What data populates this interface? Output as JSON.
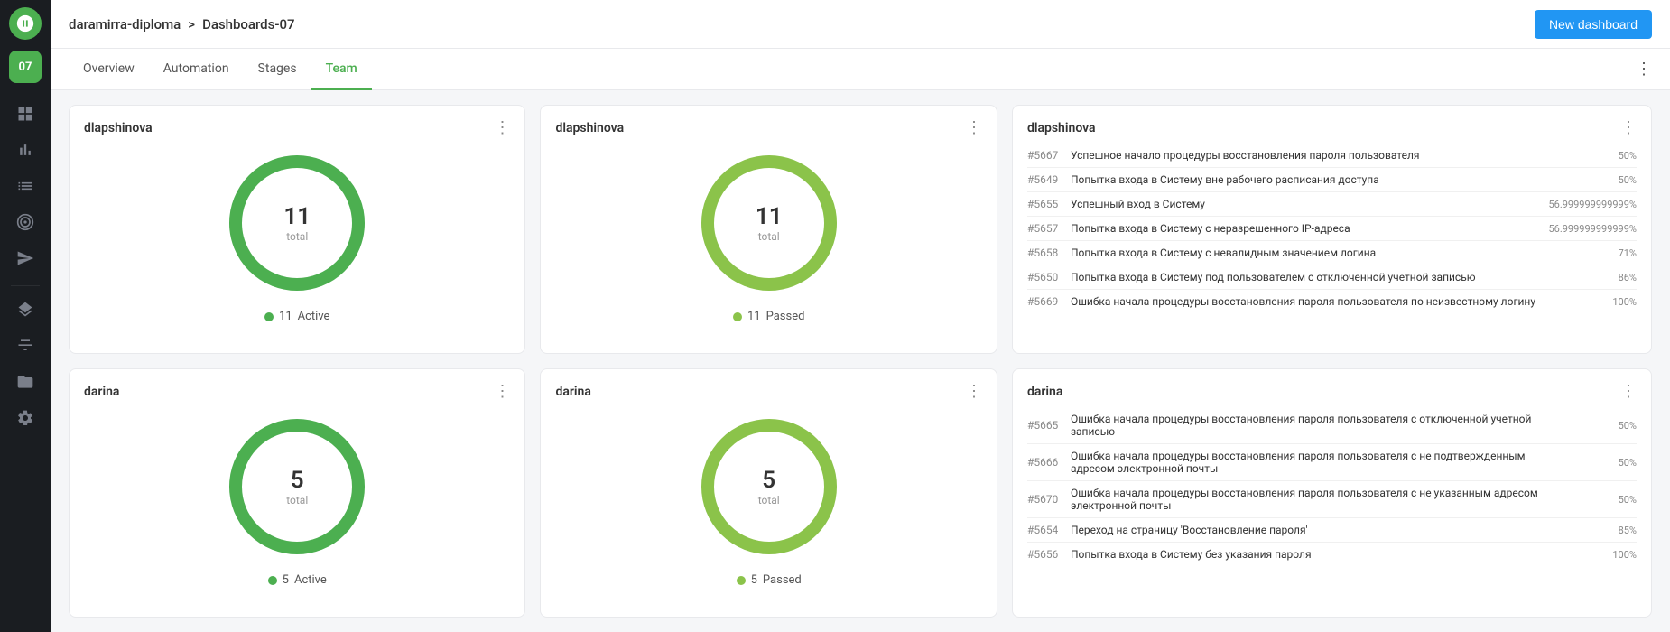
{
  "sidebar": {
    "badge": "07",
    "icons": [
      "grid",
      "chart-bar",
      "list",
      "target",
      "send",
      "layers",
      "settings-sliders",
      "folder",
      "settings"
    ]
  },
  "topbar": {
    "breadcrumb_project": "daramirra-diploma",
    "breadcrumb_sep": ">",
    "breadcrumb_dashboard": "Dashboards-07",
    "new_dashboard_label": "New dashboard"
  },
  "tabs": [
    {
      "label": "Overview",
      "active": false
    },
    {
      "label": "Automation",
      "active": false
    },
    {
      "label": "Stages",
      "active": false
    },
    {
      "label": "Team",
      "active": true
    }
  ],
  "cards": [
    {
      "id": "dlapshinova-active",
      "title": "dlapshinova",
      "type": "donut",
      "number": 11,
      "sublabel": "total",
      "legend_color": "#4caf50",
      "legend_count": 11,
      "legend_label": "Active",
      "donut_color": "#4caf50",
      "donut_bg": "#e8f5e9"
    },
    {
      "id": "dlapshinova-passed",
      "title": "dlapshinova",
      "type": "donut",
      "number": 11,
      "sublabel": "total",
      "legend_color": "#8bc34a",
      "legend_count": 11,
      "legend_label": "Passed",
      "donut_color": "#8bc34a",
      "donut_bg": "#f1f8e9"
    },
    {
      "id": "dlapshinova-list",
      "title": "dlapshinova",
      "type": "list",
      "items": [
        {
          "id": "#5667",
          "text": "Успешное начало процедуры восстановления пароля пользователя",
          "pct": "50%",
          "pct_num": 50
        },
        {
          "id": "#5649",
          "text": "Попытка входа в Систему вне рабочего расписания доступа",
          "pct": "50%",
          "pct_num": 50
        },
        {
          "id": "#5655",
          "text": "Успешный вход в Систему",
          "pct": "56.999999999999%",
          "pct_num": 57
        },
        {
          "id": "#5657",
          "text": "Попытка входа в Систему с неразрешенного IP-адреса",
          "pct": "56.999999999999%",
          "pct_num": 57
        },
        {
          "id": "#5658",
          "text": "Попытка входа в Систему с невалидным значением логина",
          "pct": "71%",
          "pct_num": 71
        },
        {
          "id": "#5650",
          "text": "Попытка входа в Систему под пользователем с отключенной учетной записью",
          "pct": "86%",
          "pct_num": 86
        },
        {
          "id": "#5669",
          "text": "Ошибка начала процедуры восстановления пароля пользователя по неизвестному логину",
          "pct": "100%",
          "pct_num": 100
        }
      ]
    },
    {
      "id": "darina-active",
      "title": "darina",
      "type": "donut",
      "number": 5,
      "sublabel": "total",
      "legend_color": "#4caf50",
      "legend_count": 5,
      "legend_label": "Active",
      "donut_color": "#4caf50",
      "donut_bg": "#e8f5e9"
    },
    {
      "id": "darina-passed",
      "title": "darina",
      "type": "donut",
      "number": 5,
      "sublabel": "total",
      "legend_color": "#8bc34a",
      "legend_count": 5,
      "legend_label": "Passed",
      "donut_color": "#8bc34a",
      "donut_bg": "#f1f8e9"
    },
    {
      "id": "darina-list",
      "title": "darina",
      "type": "list",
      "items": [
        {
          "id": "#5665",
          "text": "Ошибка начала процедуры восстановления пароля пользователя с отключенной учетной записью",
          "pct": "50%",
          "pct_num": 50
        },
        {
          "id": "#5666",
          "text": "Ошибка начала процедуры восстановления пароля пользователя с не подтвержденным адресом электронной почты",
          "pct": "50%",
          "pct_num": 50
        },
        {
          "id": "#5670",
          "text": "Ошибка начала процедуры восстановления пароля пользователя с не указанным адресом электронной почты",
          "pct": "50%",
          "pct_num": 50
        },
        {
          "id": "#5654",
          "text": "Переход на страницу 'Восстановление пароля'",
          "pct": "85%",
          "pct_num": 85
        },
        {
          "id": "#5656",
          "text": "Попытка входа в Систему без указания пароля",
          "pct": "100%",
          "pct_num": 100
        }
      ]
    }
  ]
}
